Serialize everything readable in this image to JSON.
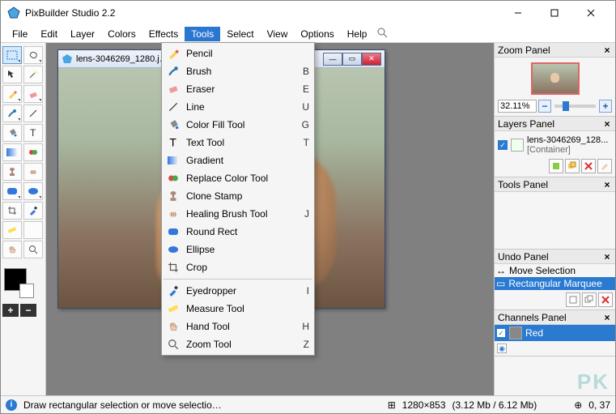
{
  "app": {
    "title": "PixBuilder Studio 2.2"
  },
  "window_controls": {
    "min": "minimize",
    "max": "maximize",
    "close": "close"
  },
  "menubar": {
    "items": [
      "File",
      "Edit",
      "Layer",
      "Colors",
      "Effects",
      "Tools",
      "Select",
      "View",
      "Options",
      "Help"
    ],
    "active_index": 5
  },
  "tools_menu": {
    "groups": [
      [
        {
          "icon": "pencil-icon",
          "label": "Pencil",
          "key": ""
        },
        {
          "icon": "brush-icon",
          "label": "Brush",
          "key": "B"
        },
        {
          "icon": "eraser-icon",
          "label": "Eraser",
          "key": "E"
        },
        {
          "icon": "line-icon",
          "label": "Line",
          "key": "U"
        },
        {
          "icon": "bucket-icon",
          "label": "Color Fill Tool",
          "key": "G"
        },
        {
          "icon": "text-icon",
          "label": "Text Tool",
          "key": "T"
        },
        {
          "icon": "gradient-icon",
          "label": "Gradient",
          "key": ""
        },
        {
          "icon": "replace-color-icon",
          "label": "Replace Color Tool",
          "key": ""
        },
        {
          "icon": "clone-stamp-icon",
          "label": "Clone Stamp",
          "key": ""
        },
        {
          "icon": "healing-brush-icon",
          "label": "Healing Brush Tool",
          "key": "J"
        },
        {
          "icon": "round-rect-icon",
          "label": "Round Rect",
          "key": ""
        },
        {
          "icon": "ellipse-icon",
          "label": "Ellipse",
          "key": ""
        },
        {
          "icon": "crop-icon",
          "label": "Crop",
          "key": ""
        }
      ],
      [
        {
          "icon": "eyedropper-icon",
          "label": "Eyedropper",
          "key": "I"
        },
        {
          "icon": "measure-icon",
          "label": "Measure Tool",
          "key": ""
        },
        {
          "icon": "hand-icon",
          "label": "Hand Tool",
          "key": "H"
        },
        {
          "icon": "zoom-icon",
          "label": "Zoom Tool",
          "key": "Z"
        }
      ]
    ]
  },
  "toolbox": {
    "tools": [
      [
        "marquee",
        "lasso"
      ],
      [
        "move",
        "wand"
      ],
      [
        "pencil",
        "eraser"
      ],
      [
        "brush",
        "line"
      ],
      [
        "bucket",
        "text"
      ],
      [
        "gradient",
        "replace"
      ],
      [
        "stamp",
        "heal"
      ],
      [
        "roundrect",
        "ellipse"
      ],
      [
        "crop",
        "eyedropper"
      ],
      [
        "measure",
        "blank"
      ],
      [
        "hand",
        "zoom"
      ]
    ],
    "active": "marquee"
  },
  "document": {
    "title": "lens-3046269_1280.j…",
    "image_dims": "1280×853",
    "mem": "(3.12 Mb / 6.12 Mb)"
  },
  "panels": {
    "zoom": {
      "title": "Zoom Panel",
      "value": "32.11%"
    },
    "layers": {
      "title": "Layers Panel",
      "items": [
        {
          "name": "lens-3046269_128...",
          "sub": "[Container]"
        }
      ]
    },
    "tools": {
      "title": "Tools Panel"
    },
    "undo": {
      "title": "Undo Panel",
      "items": [
        "Move Selection",
        "Rectangular Marquee"
      ],
      "active_index": 1
    },
    "channels": {
      "title": "Channels Panel",
      "items": [
        "Red"
      ]
    }
  },
  "status": {
    "hint": "Draw rectangular selection or move selectio…",
    "coords": "0, 37"
  },
  "watermark": "PK"
}
